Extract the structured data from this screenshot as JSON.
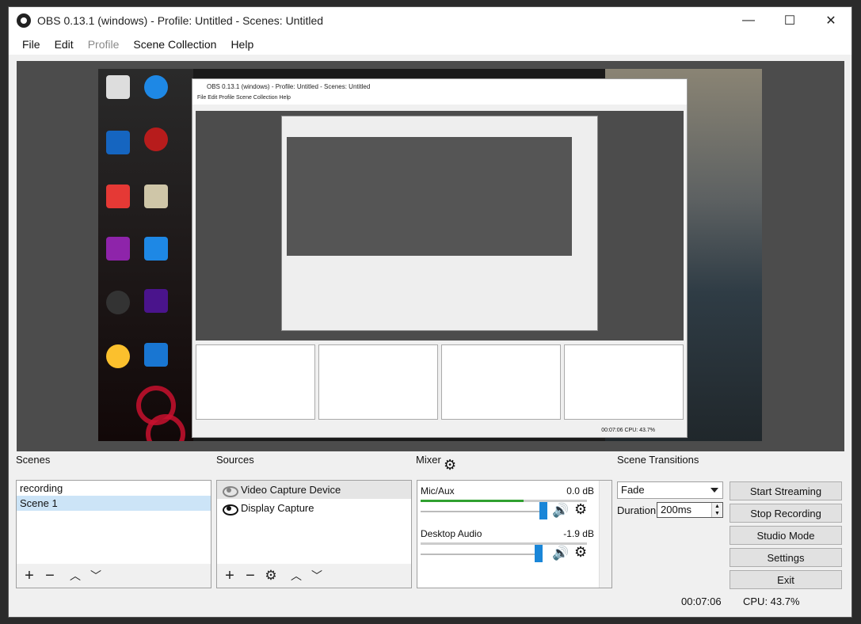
{
  "window": {
    "title": "OBS 0.13.1 (windows) - Profile: Untitled - Scenes: Untitled",
    "minimize": "—",
    "maximize": "☐",
    "close": "✕"
  },
  "menu": [
    "File",
    "Edit",
    "Profile",
    "Scene Collection",
    "Help"
  ],
  "nested_preview": {
    "title": "OBS 0.13.1 (windows) - Profile: Untitled - Scenes: Untitled",
    "menu": "File  Edit  Profile  Scene Collection  Help",
    "status": "00:07:06     CPU: 43.7%"
  },
  "docks": {
    "scenes": "Scenes",
    "sources": "Sources",
    "mixer": "Mixer",
    "transitions": "Scene Transitions"
  },
  "scenes": [
    "recording",
    "Scene 1"
  ],
  "sources": [
    "Video Capture Device",
    "Display Capture"
  ],
  "mixer": [
    {
      "name": "Mic/Aux",
      "db": "0.0 dB",
      "level": 0.62,
      "volume": 1.0
    },
    {
      "name": "Desktop Audio",
      "db": "-1.9 dB",
      "level": 0.0,
      "volume": 0.96
    }
  ],
  "transitions": {
    "selected": "Fade",
    "duration_label": "Duration",
    "duration_value": "200ms"
  },
  "controls": [
    "Start Streaming",
    "Stop Recording",
    "Studio Mode",
    "Settings",
    "Exit"
  ],
  "status": {
    "time": "00:07:06",
    "cpu": "CPU: 43.7%"
  },
  "icons": {
    "add": "+",
    "remove": "−",
    "up": "︿",
    "down": "﹀",
    "gear": "⚙",
    "speaker": "🔊"
  }
}
